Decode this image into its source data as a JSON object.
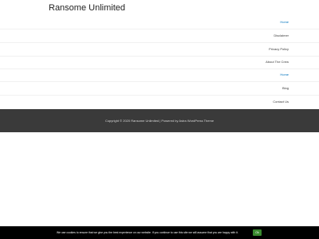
{
  "site": {
    "title": "Ransome Unlimited"
  },
  "nav": {
    "items": [
      {
        "label": "Home",
        "active": true
      },
      {
        "label": "Disclaimer",
        "active": false
      },
      {
        "label": "Privacy Policy",
        "active": false
      },
      {
        "label": "About The Crew",
        "active": false
      },
      {
        "label": "Home",
        "active": true
      },
      {
        "label": "Blog",
        "active": false
      },
      {
        "label": "Contact Us",
        "active": false
      }
    ]
  },
  "footer": {
    "copyright": "Copyright © 2020 Ransome Unlimited | Powered by Astra WordPress Theme"
  },
  "cookie": {
    "message": "We use cookies to ensure that we give you the best experience on our website. If you continue to use this site we will assume that you are happy with it.",
    "ok_label": "Ok"
  },
  "colors": {
    "accent": "#0274be",
    "footer_bg": "#3a3a3a",
    "cookie_bg": "#000000",
    "cookie_button": "#3a8a2f"
  }
}
